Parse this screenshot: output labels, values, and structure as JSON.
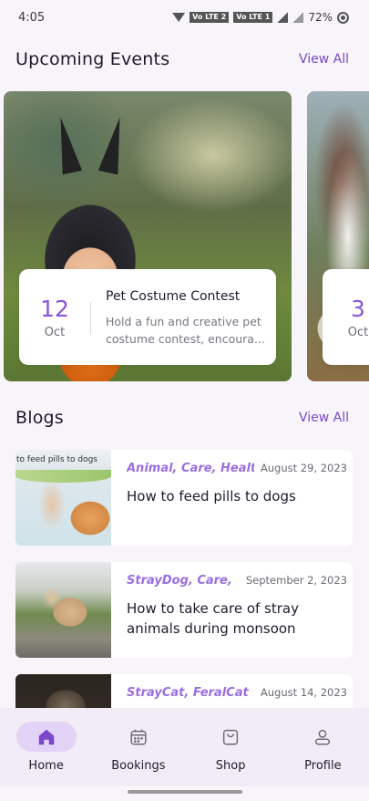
{
  "status_bar": {
    "time": "4:05",
    "volte1": "Vo LTE 2",
    "volte2": "Vo LTE 1",
    "battery": "72%"
  },
  "events": {
    "title": "Upcoming Events",
    "view_all": "View All",
    "items": [
      {
        "day": "12",
        "month": "Oct",
        "title": "Pet Costume Contest",
        "description": "Hold a fun and creative pet costume contest, encoura..."
      },
      {
        "day": "3",
        "month": "Oct",
        "title": "",
        "description": ""
      }
    ]
  },
  "blogs": {
    "title": "Blogs",
    "view_all": "View All",
    "items": [
      {
        "tags": "Animal, Care, Health",
        "date": "August 29, 2023",
        "title": "How to feed pills to dogs",
        "thumb_caption": "to feed pills to dogs"
      },
      {
        "tags": "StrayDog, Care, Ar",
        "date": "September 2, 2023",
        "title": "How to take care of stray animals during monsoon"
      },
      {
        "tags": "StrayCat, FeralCat",
        "date": "August 14, 2023",
        "title": ""
      }
    ]
  },
  "nav": {
    "items": [
      {
        "label": "Home",
        "icon": "home-icon",
        "active": true
      },
      {
        "label": "Bookings",
        "icon": "calendar-icon",
        "active": false
      },
      {
        "label": "Shop",
        "icon": "shopping-bag-icon",
        "active": false
      },
      {
        "label": "Profile",
        "icon": "person-icon",
        "active": false
      }
    ]
  },
  "colors": {
    "accent": "#7b48c9",
    "tag": "#9b6ee0",
    "nav_active": "#e3d3f7",
    "background": "#f7f4fa"
  }
}
